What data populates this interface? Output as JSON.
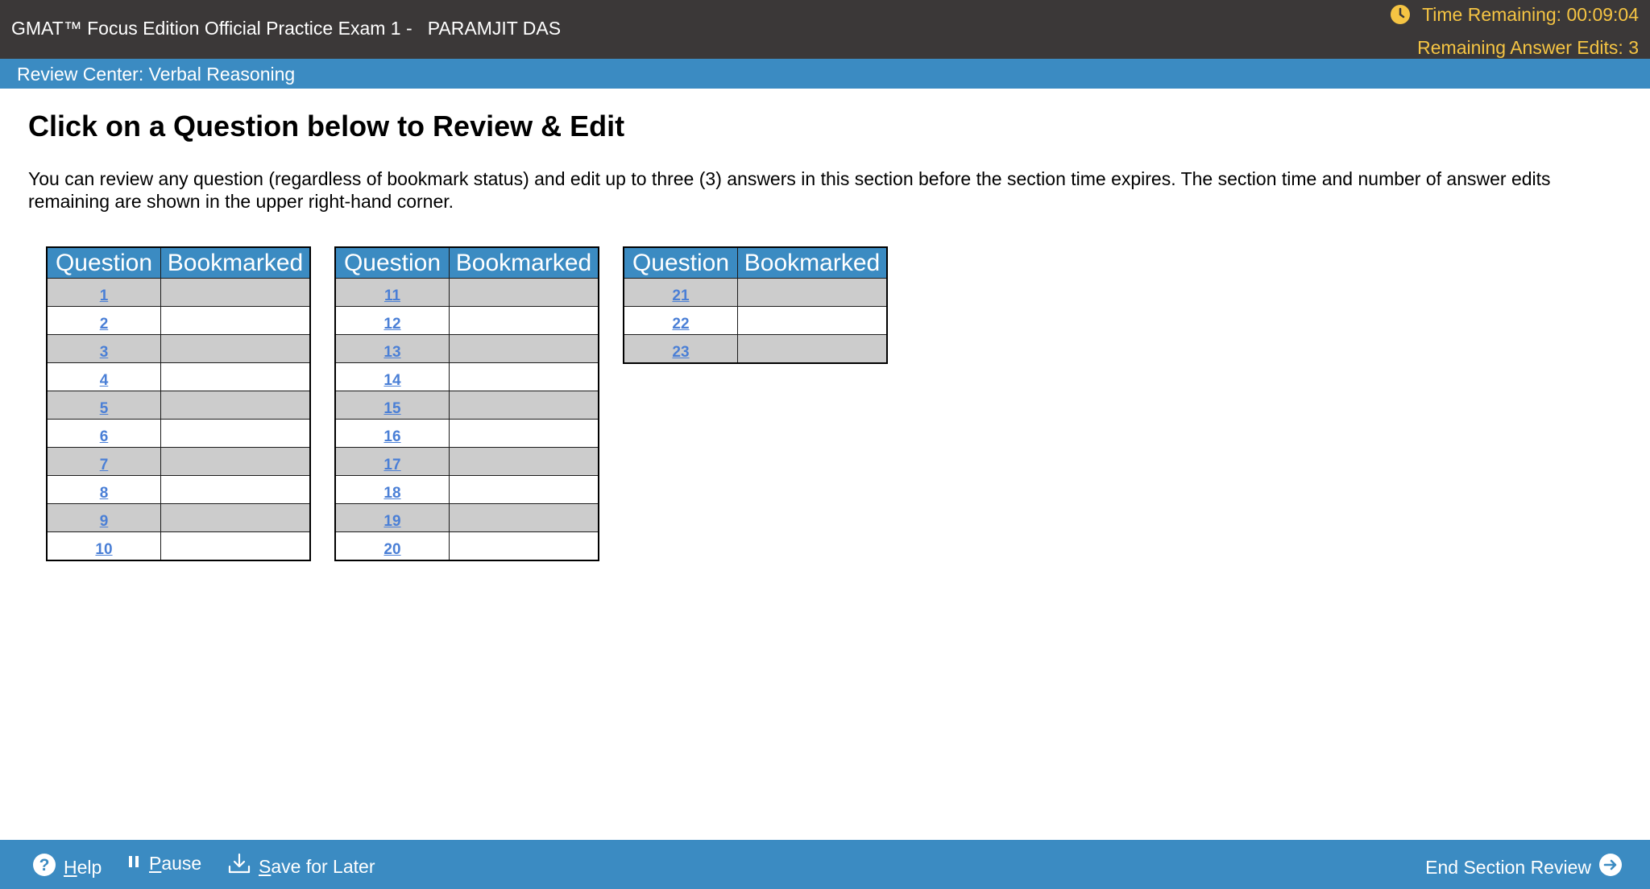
{
  "header": {
    "exam_title": "GMAT™ Focus Edition Official Practice Exam 1 -   PARAMJIT DAS",
    "time_remaining": "Time Remaining: 00:09:04",
    "answer_edits": "Remaining Answer Edits: 3",
    "accent_color": "#f5c443",
    "icon": "clock-icon"
  },
  "section_bar": {
    "title": "Review Center: Verbal Reasoning"
  },
  "main": {
    "heading": "Click on a Question below to Review & Edit",
    "instructions": "You can review any question (regardless of bookmark status) and edit up to three (3) answers in this section before the section time expires. The section time and number of answer edits remaining are shown in the upper right-hand corner."
  },
  "tables": [
    {
      "header_question": "Question",
      "header_bookmarked": "Bookmarked",
      "rows": [
        {
          "q": "1",
          "bookmarked": ""
        },
        {
          "q": "2",
          "bookmarked": ""
        },
        {
          "q": "3",
          "bookmarked": ""
        },
        {
          "q": "4",
          "bookmarked": ""
        },
        {
          "q": "5",
          "bookmarked": ""
        },
        {
          "q": "6",
          "bookmarked": ""
        },
        {
          "q": "7",
          "bookmarked": ""
        },
        {
          "q": "8",
          "bookmarked": ""
        },
        {
          "q": "9",
          "bookmarked": ""
        },
        {
          "q": "10",
          "bookmarked": ""
        }
      ]
    },
    {
      "header_question": "Question",
      "header_bookmarked": "Bookmarked",
      "rows": [
        {
          "q": "11",
          "bookmarked": ""
        },
        {
          "q": "12",
          "bookmarked": ""
        },
        {
          "q": "13",
          "bookmarked": ""
        },
        {
          "q": "14",
          "bookmarked": ""
        },
        {
          "q": "15",
          "bookmarked": ""
        },
        {
          "q": "16",
          "bookmarked": ""
        },
        {
          "q": "17",
          "bookmarked": ""
        },
        {
          "q": "18",
          "bookmarked": ""
        },
        {
          "q": "19",
          "bookmarked": ""
        },
        {
          "q": "20",
          "bookmarked": ""
        }
      ]
    },
    {
      "header_question": "Question",
      "header_bookmarked": "Bookmarked",
      "rows": [
        {
          "q": "21",
          "bookmarked": ""
        },
        {
          "q": "22",
          "bookmarked": ""
        },
        {
          "q": "23",
          "bookmarked": ""
        }
      ]
    }
  ],
  "footer": {
    "help": {
      "underline": "H",
      "rest": "elp",
      "icon": "help-circle-icon"
    },
    "pause": {
      "underline": "P",
      "rest": "ause",
      "icon": "pause-icon"
    },
    "save": {
      "underline": "S",
      "rest": "ave for Later",
      "icon": "download-icon"
    },
    "end_section_review": {
      "label": "End Section Review",
      "icon": "arrow-right-circle-icon"
    }
  }
}
